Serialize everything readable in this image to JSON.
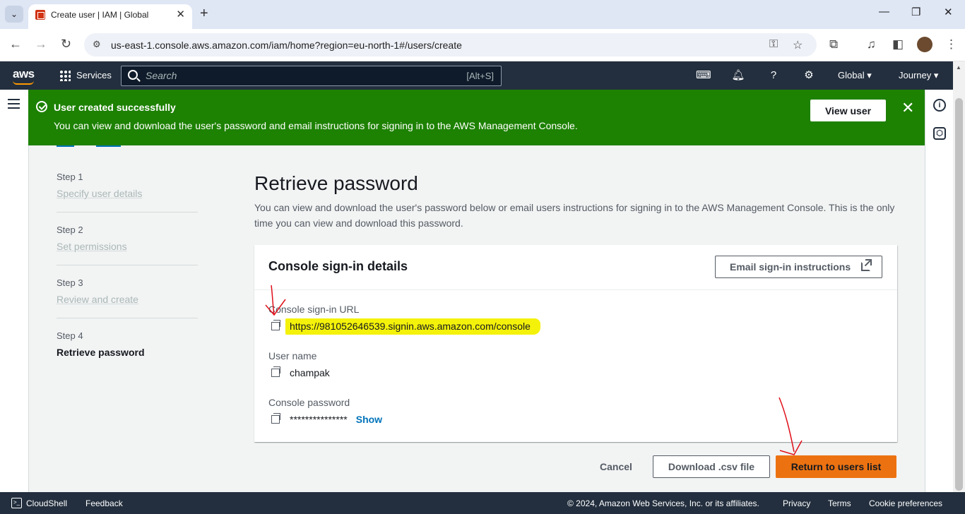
{
  "browser": {
    "tab_title": "Create user | IAM | Global",
    "url": "us-east-1.console.aws.amazon.com/iam/home?region=eu-north-1#/users/create"
  },
  "aws_nav": {
    "logo": "aws",
    "services_label": "Services",
    "search_placeholder": "Search",
    "search_shortcut": "[Alt+S]",
    "region_label": "Global",
    "account_label": "Journey"
  },
  "flash": {
    "title": "User created successfully",
    "message": "You can view and download the user's password and email instructions for signing in to the AWS Management Console.",
    "button_label": "View user",
    "color": "#1d8102"
  },
  "steps": [
    {
      "number": "Step 1",
      "label": "Specify user details",
      "active": false
    },
    {
      "number": "Step 2",
      "label": "Set permissions",
      "active": false
    },
    {
      "number": "Step 3",
      "label": "Review and create",
      "active": false
    },
    {
      "number": "Step 4",
      "label": "Retrieve password",
      "active": true
    }
  ],
  "page": {
    "title": "Retrieve password",
    "description": "You can view and download the user's password below or email users instructions for signing in to the AWS Management Console. This is the only time you can view and download this password."
  },
  "card": {
    "title": "Console sign-in details",
    "email_button_label": "Email sign-in instructions",
    "fields": {
      "url_label": "Console sign-in URL",
      "url_value": "https://981052646539.signin.aws.amazon.com/console",
      "username_label": "User name",
      "username_value": "champak",
      "password_label": "Console password",
      "password_value": "***************",
      "show_label": "Show"
    }
  },
  "actions": {
    "cancel_label": "Cancel",
    "download_label": "Download .csv file",
    "primary_label": "Return to users list",
    "primary_color": "#ec7211"
  },
  "footer": {
    "cloudshell_label": "CloudShell",
    "feedback_label": "Feedback",
    "copyright": "© 2024, Amazon Web Services, Inc. or its affiliates.",
    "privacy_label": "Privacy",
    "terms_label": "Terms",
    "cookie_label": "Cookie preferences"
  }
}
